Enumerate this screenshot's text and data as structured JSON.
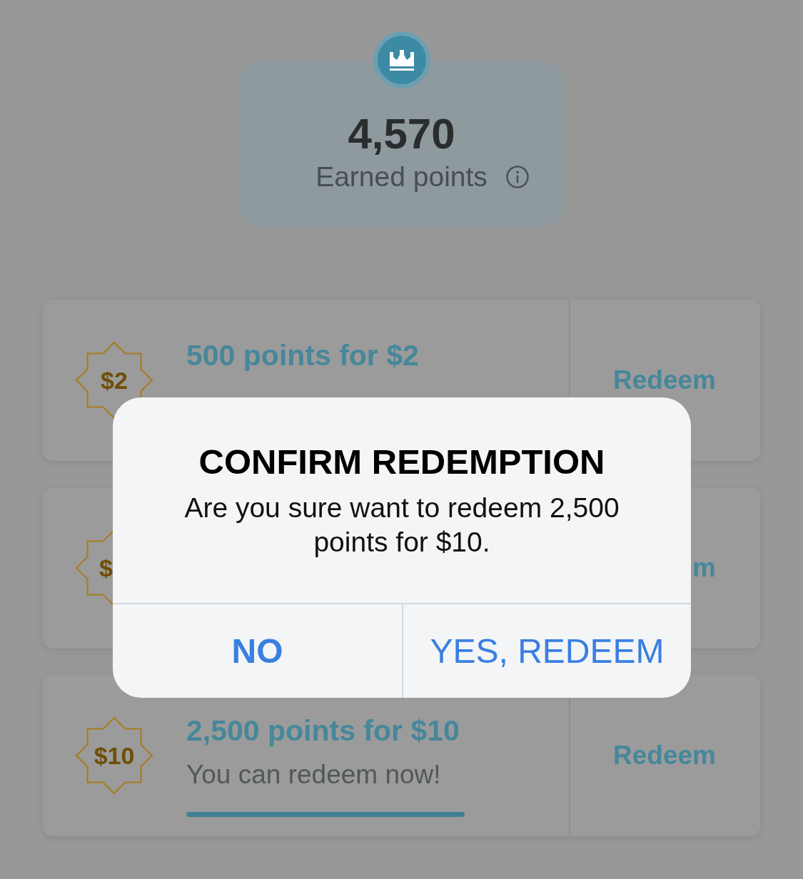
{
  "summary": {
    "points": "4,570",
    "label": "Earned points"
  },
  "rewards": [
    {
      "badge": "$2",
      "badge_clipped": false,
      "title": "500 points for $2",
      "action": "Redeem"
    },
    {
      "badge": "$",
      "badge_clipped": true,
      "action": "m"
    },
    {
      "badge": "$10",
      "badge_clipped": false,
      "title": "2,500 points for $10",
      "subtitle": "You can redeem now!",
      "level": 1,
      "action": "Redeem"
    }
  ],
  "dialog": {
    "title": "CONFIRM REDEMPTION",
    "message": "Are you sure want to redeem 2,500 points for $10.",
    "buttons": [
      {
        "label": "NO",
        "kind": "cancel"
      },
      {
        "label": "YES, REDEEM",
        "kind": "confirm"
      }
    ]
  }
}
